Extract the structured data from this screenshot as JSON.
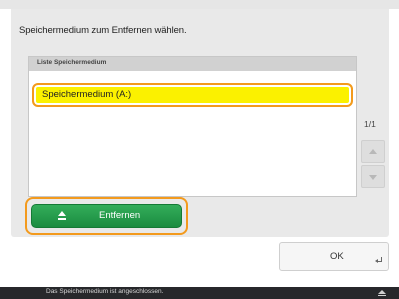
{
  "dialog": {
    "prompt": "Speichermedium zum Entfernen wählen."
  },
  "media_list": {
    "header": "Liste Speichermedium",
    "items": [
      {
        "label": "Speichermedium (A:)",
        "selected": true
      }
    ],
    "page_counter": "1/1"
  },
  "buttons": {
    "remove_label": "Entfernen",
    "ok_label": "OK"
  },
  "status_bar": {
    "message": "Das Speichermedium ist angeschlossen."
  },
  "icons": {
    "remove": "eject-icon",
    "ok": "enter-icon",
    "status": "eject-icon",
    "scroll_up": "triangle-up-icon",
    "scroll_down": "triangle-down-icon"
  },
  "colors": {
    "selection_fill": "#fbf100",
    "focus_outline": "#f39a1d",
    "remove_button": "#1b8c40",
    "status_bar": "#27282b"
  }
}
